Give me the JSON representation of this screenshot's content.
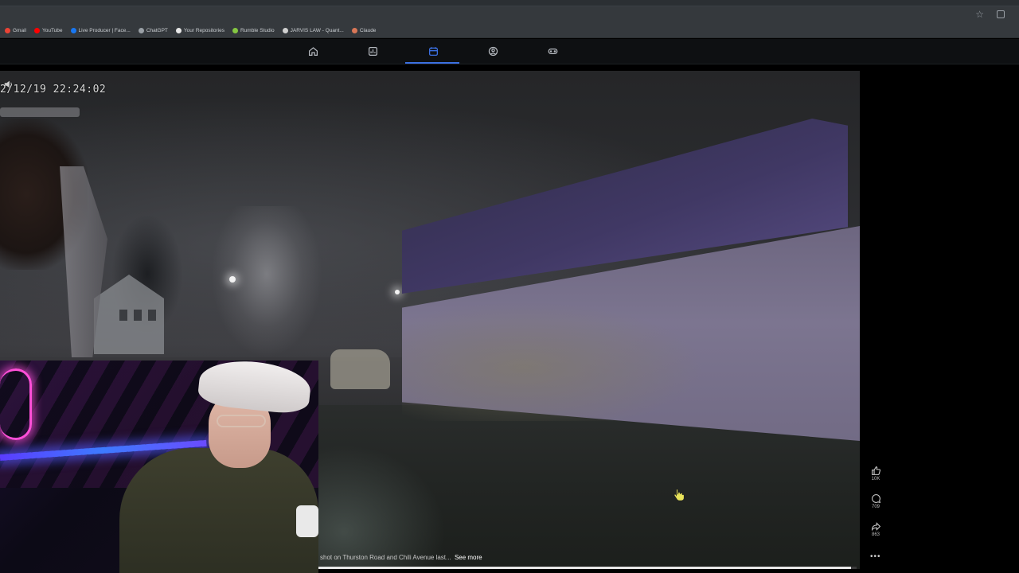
{
  "browser": {
    "bookmarks": [
      {
        "label": "Gmail",
        "color": "#ea4335"
      },
      {
        "label": "YouTube",
        "color": "#ff0000"
      },
      {
        "label": "Live Producer | Face...",
        "color": "#1877f2"
      },
      {
        "label": "ChatGPT",
        "color": "#9aa0a6"
      },
      {
        "label": "Your Repositories",
        "color": "#e8e8e8"
      },
      {
        "label": "Rumble Studio",
        "color": "#85c742"
      },
      {
        "label": "JARVIS LAW - Quant...",
        "color": "#d0d0d0"
      },
      {
        "label": "Claude",
        "color": "#d97757"
      }
    ]
  },
  "nav": {
    "tabs": [
      {
        "name": "home",
        "icon": "home-icon"
      },
      {
        "name": "stats",
        "icon": "chart-icon"
      },
      {
        "name": "calendar",
        "icon": "calendar-icon",
        "active": true
      },
      {
        "name": "profile",
        "icon": "profile-icon"
      },
      {
        "name": "games",
        "icon": "gamepad-icon"
      }
    ],
    "active_color": "#3b6fe0"
  },
  "video": {
    "timestamp": "2/12/19 22:24:02",
    "caption": "shot on Thurston Road and Chili Avenue last...",
    "see_more": "See more",
    "progress": 0.99
  },
  "actions": {
    "likes": "10K",
    "comments": "709",
    "shares": "863",
    "more": "•••"
  }
}
